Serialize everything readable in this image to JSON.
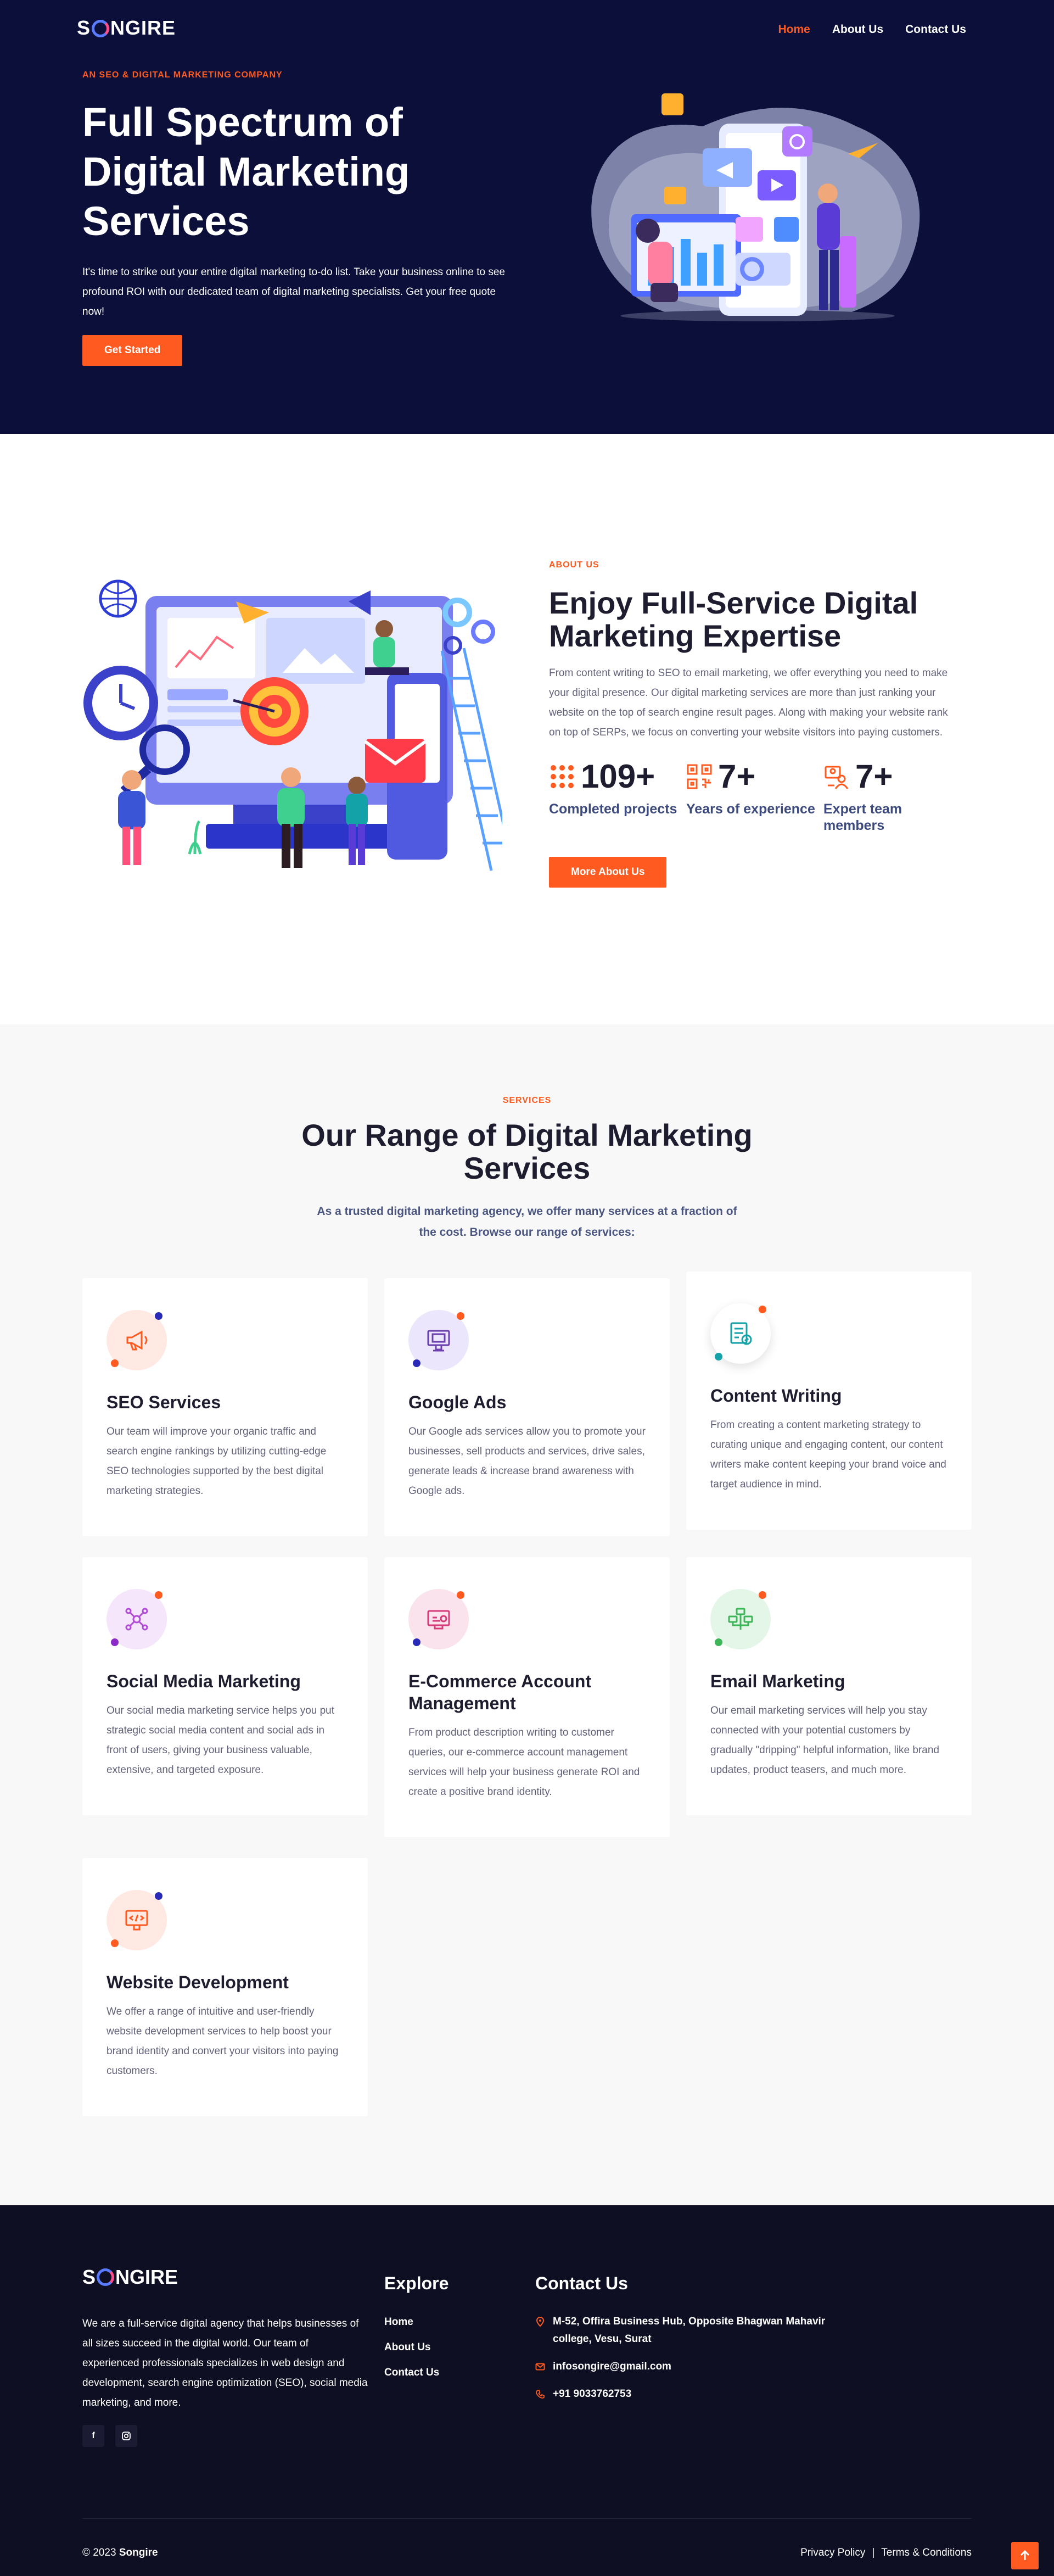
{
  "brand": {
    "logo_pre": "S",
    "logo_post": "NGIRE"
  },
  "nav": {
    "home": "Home",
    "about": "About Us",
    "contact": "Contact Us"
  },
  "hero": {
    "eyebrow": "AN SEO & DIGITAL MARKETING COMPANY",
    "title": "Full Spectrum of Digital Marketing Services",
    "text": "It's time to strike out your entire digital marketing to-do list. Take your business online to see profound ROI with our dedicated team of digital marketing specialists. Get your free quote now!",
    "cta": "Get Started"
  },
  "about": {
    "eyebrow": "ABOUT US",
    "title": "Enjoy Full-Service Digital Marketing Expertise",
    "text": "From content writing to SEO to email marketing, we offer everything you need to make your digital presence. Our digital marketing services are more than just ranking your website on the top of search engine result pages. Along with making your website rank on top of SERPs, we focus on converting your website visitors into paying customers.",
    "stats": [
      {
        "value": "109+",
        "label": "Completed projects"
      },
      {
        "value": "7+",
        "label": "Years of experience"
      },
      {
        "value": "7+",
        "label": "Expert team members"
      }
    ],
    "cta": "More About Us"
  },
  "services": {
    "eyebrow": "SERVICES",
    "title": "Our Range of Digital Marketing Services",
    "subtitle": "As a trusted digital marketing agency, we offer many services at a fraction of the cost. Browse our range of services:",
    "cards": [
      {
        "title": "SEO Services",
        "text": "Our team will improve your organic traffic and search engine rankings by utilizing cutting-edge SEO technologies supported by the best digital marketing strategies."
      },
      {
        "title": "Google Ads",
        "text": "Our Google ads services allow you to promote your businesses, sell products and services, drive sales, generate leads & increase brand awareness with Google ads."
      },
      {
        "title": "Content Writing",
        "text": "From creating a content marketing strategy to curating unique and engaging content, our content writers make content keeping your brand voice and target audience in mind."
      },
      {
        "title": "Social Media Marketing",
        "text": "Our social media marketing service helps you put strategic social media content and social ads in front of users, giving your business valuable, extensive, and targeted exposure."
      },
      {
        "title": "E-Commerce Account Management",
        "text": "From product description writing to customer queries, our e-commerce account management services will help your business generate ROI and create a positive brand identity."
      },
      {
        "title": "Email Marketing",
        "text": "Our email marketing services will help you stay connected with your potential customers by gradually \"dripping\" helpful information, like brand updates, product teasers, and much more."
      },
      {
        "title": "Website Development",
        "text": "We offer a range of intuitive and user-friendly website development services to help boost your brand identity and convert your visitors into paying customers."
      }
    ]
  },
  "footer": {
    "about": "We are a full-service digital agency that helps businesses of all sizes succeed in the digital world. Our team of experienced professionals specializes in web design and development, search engine optimization (SEO), social media marketing, and more.",
    "social_facebook": "f",
    "explore_title": "Explore",
    "links": [
      "Home",
      "About Us",
      "Contact Us"
    ],
    "contact_title": "Contact Us",
    "address": "M-52, Offira Business Hub, Opposite Bhagwan Mahavir college, Vesu, Surat",
    "email": "infosongire@gmail.com",
    "phone": "+91 9033762753",
    "copyright_prefix": "© 2023",
    "copyright_brand": "Songire",
    "privacy": "Privacy Policy",
    "separator": "|",
    "terms": "Terms & Conditions"
  },
  "icons": {
    "social": [
      "facebook-icon",
      "instagram-icon"
    ],
    "contact": [
      "map-pin-icon",
      "mail-icon",
      "phone-icon"
    ],
    "stats": [
      "grid-dots-icon",
      "qr-code-icon",
      "team-icon"
    ],
    "services": [
      "megaphone-icon",
      "ads-monitor-icon",
      "content-edit-icon",
      "social-network-icon",
      "ecommerce-icon",
      "email-tree-icon",
      "web-dev-icon"
    ],
    "back_to_top": "arrow-up-icon"
  },
  "colors": {
    "accent": "#ff5a1f",
    "hero_bg": "#0b0f3a",
    "footer_bg": "#0e0f22",
    "heading": "#1d1d2f",
    "stat_label": "#3d4a7d"
  }
}
